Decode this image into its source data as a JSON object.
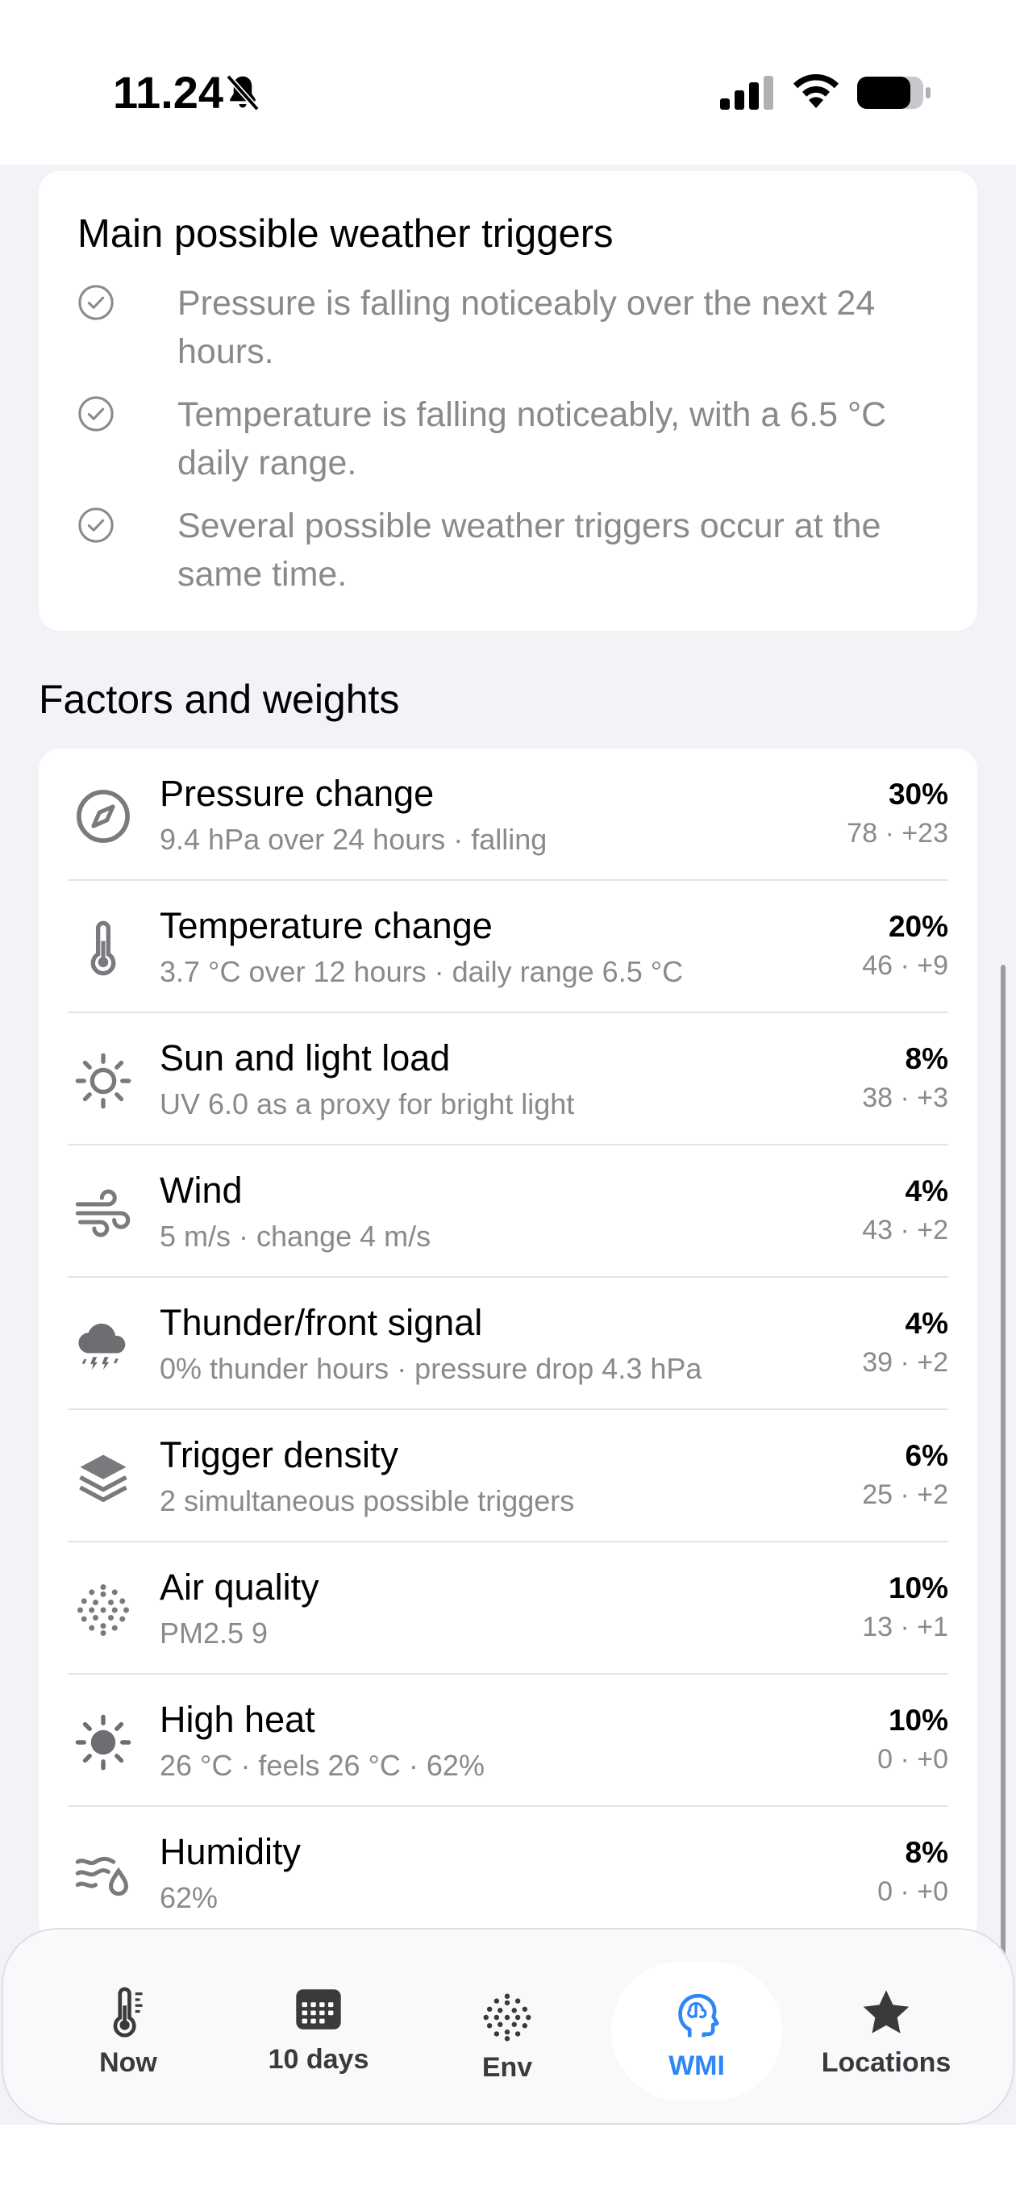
{
  "status_bar": {
    "time": "11.24",
    "icons": [
      "bell-slash-icon",
      "cellular-signal-icon",
      "wifi-icon",
      "battery-icon"
    ]
  },
  "triggers": {
    "title": "Main possible weather triggers",
    "items": [
      {
        "text": "Pressure is falling noticeably over the next 24 hours."
      },
      {
        "text": "Temperature is falling noticeably, with a 6.5 °C daily range."
      },
      {
        "text": "Several possible weather triggers occur at the same time."
      }
    ]
  },
  "factors": {
    "title": "Factors and weights",
    "rows": [
      {
        "icon": "compass-icon",
        "name": "Pressure change",
        "detail": "9.4 hPa over 24 hours · falling",
        "weight": "30%",
        "score": "78 · +23"
      },
      {
        "icon": "thermometer-icon",
        "name": "Temperature change",
        "detail": "3.7 °C over 12 hours · daily range 6.5 °C",
        "weight": "20%",
        "score": "46 · +9"
      },
      {
        "icon": "sun-icon",
        "name": "Sun and light load",
        "detail": "UV 6.0 as a proxy for bright light",
        "weight": "8%",
        "score": "38 · +3"
      },
      {
        "icon": "wind-icon",
        "name": "Wind",
        "detail": "5 m/s · change 4 m/s",
        "weight": "4%",
        "score": "43 · +2"
      },
      {
        "icon": "thunderstorm-icon",
        "name": "Thunder/front signal",
        "detail": "0% thunder hours · pressure drop 4.3 hPa",
        "weight": "4%",
        "score": "39 · +2"
      },
      {
        "icon": "layers-icon",
        "name": "Trigger density",
        "detail": "2 simultaneous possible triggers",
        "weight": "6%",
        "score": "25 · +2"
      },
      {
        "icon": "dots-icon",
        "name": "Air quality",
        "detail": "PM2.5 9",
        "weight": "10%",
        "score": "13 · +1"
      },
      {
        "icon": "sun-filled-icon",
        "name": "High heat",
        "detail": "26 °C · feels 26 °C · 62%",
        "weight": "10%",
        "score": "0 · +0"
      },
      {
        "icon": "humidity-icon",
        "name": "Humidity",
        "detail": "62%",
        "weight": "8%",
        "score": "0 · +0"
      }
    ]
  },
  "tabbar": {
    "active_color": "#2f86f6",
    "tabs": [
      {
        "label": "Now",
        "icon": "thermometer-icon",
        "active": false
      },
      {
        "label": "10 days",
        "icon": "calendar-icon",
        "active": false
      },
      {
        "label": "Env",
        "icon": "dots-icon",
        "active": false
      },
      {
        "label": "WMI",
        "icon": "brain-head-icon",
        "active": true
      },
      {
        "label": "Locations",
        "icon": "star-icon",
        "active": false
      }
    ]
  }
}
